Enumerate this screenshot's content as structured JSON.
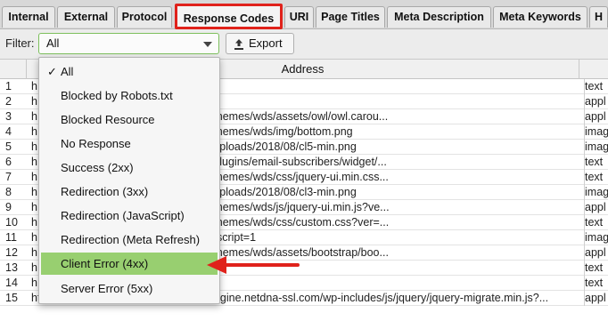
{
  "tabs": [
    {
      "label": "Internal",
      "active": false
    },
    {
      "label": "External",
      "active": false
    },
    {
      "label": "Protocol",
      "active": false
    },
    {
      "label": "Response Codes",
      "active": true
    },
    {
      "label": "URI",
      "active": false
    },
    {
      "label": "Page Titles",
      "active": false
    },
    {
      "label": "Meta Description",
      "active": false
    },
    {
      "label": "Meta Keywords",
      "active": false
    },
    {
      "label": "H",
      "active": false
    }
  ],
  "toolbar": {
    "filter_label": "Filter:",
    "filter_value": "All",
    "export_label": "Export"
  },
  "grid": {
    "address_header": "Address",
    "rows": [
      {
        "n": "1",
        "address": "h",
        "type": "text"
      },
      {
        "n": "2",
        "address": "h                              min.js?ver=3",
        "type": "appl"
      },
      {
        "n": "3",
        "address": "h                              engine.netdna-ssl.com/wp-content/themes/wds/assets/owl/owl.carou...",
        "type": "appl"
      },
      {
        "n": "4",
        "address": "h                              engine.netdna-ssl.com/wp-content/themes/wds/img/bottom.png",
        "type": "imag"
      },
      {
        "n": "5",
        "address": "h                              engine.netdna-ssl.com/wp-content/uploads/2018/08/cl5-min.png",
        "type": "imag"
      },
      {
        "n": "6",
        "address": "h                              engine.netdna-ssl.com/wp-content/plugins/email-subscribers/widget/...",
        "type": "text"
      },
      {
        "n": "7",
        "address": "h                              engine.netdna-ssl.com/wp-content/themes/wds/css/jquery-ui.min.css...",
        "type": "text"
      },
      {
        "n": "8",
        "address": "h                              engine.netdna-ssl.com/wp-content/uploads/2018/08/cl3-min.png",
        "type": "imag"
      },
      {
        "n": "9",
        "address": "h                              engine.netdna-ssl.com/wp-content/themes/wds/js/jquery-ui.min.js?ve...",
        "type": "appl"
      },
      {
        "n": "10",
        "address": "h                              engine.netdna-ssl.com/wp-content/themes/wds/css/custom.css?ver=...",
        "type": "text"
      },
      {
        "n": "11",
        "address": "h                              6129935972740&ev=PageView&noscript=1",
        "type": "imag"
      },
      {
        "n": "12",
        "address": "h                              engine.netdna-ssl.com/wp-content/themes/wds/assets/bootstrap/boo...",
        "type": "appl"
      },
      {
        "n": "13",
        "address": "h                              olicy/",
        "type": "text"
      },
      {
        "n": "14",
        "address": "h                              ng/",
        "type": "text"
      },
      {
        "n": "15",
        "address": "https://4vziu2xs9t32hsrll2fcuhn8-wpengine.netdna-ssl.com/wp-includes/js/jquery/jquery-migrate.min.js?...",
        "type": "appl"
      }
    ]
  },
  "filter_menu": {
    "items": [
      {
        "label": "All",
        "checked": true,
        "highlighted": false
      },
      {
        "label": "Blocked by Robots.txt",
        "checked": false,
        "highlighted": false
      },
      {
        "label": "Blocked Resource",
        "checked": false,
        "highlighted": false
      },
      {
        "label": "No Response",
        "checked": false,
        "highlighted": false
      },
      {
        "label": "Success (2xx)",
        "checked": false,
        "highlighted": false
      },
      {
        "label": "Redirection (3xx)",
        "checked": false,
        "highlighted": false
      },
      {
        "label": "Redirection (JavaScript)",
        "checked": false,
        "highlighted": false
      },
      {
        "label": "Redirection (Meta Refresh)",
        "checked": false,
        "highlighted": false
      },
      {
        "label": "Client Error (4xx)",
        "checked": false,
        "highlighted": true
      },
      {
        "label": "Server Error (5xx)",
        "checked": false,
        "highlighted": false
      }
    ],
    "check_glyph": "✓"
  },
  "colors": {
    "active_tab_border": "#e0221b",
    "menu_highlight": "#98cf70",
    "arrow": "#e0221b"
  },
  "icons": {
    "export": "export-upload-icon",
    "dropdown": "chevron-down-icon",
    "annotation": "red-arrow-icon"
  }
}
